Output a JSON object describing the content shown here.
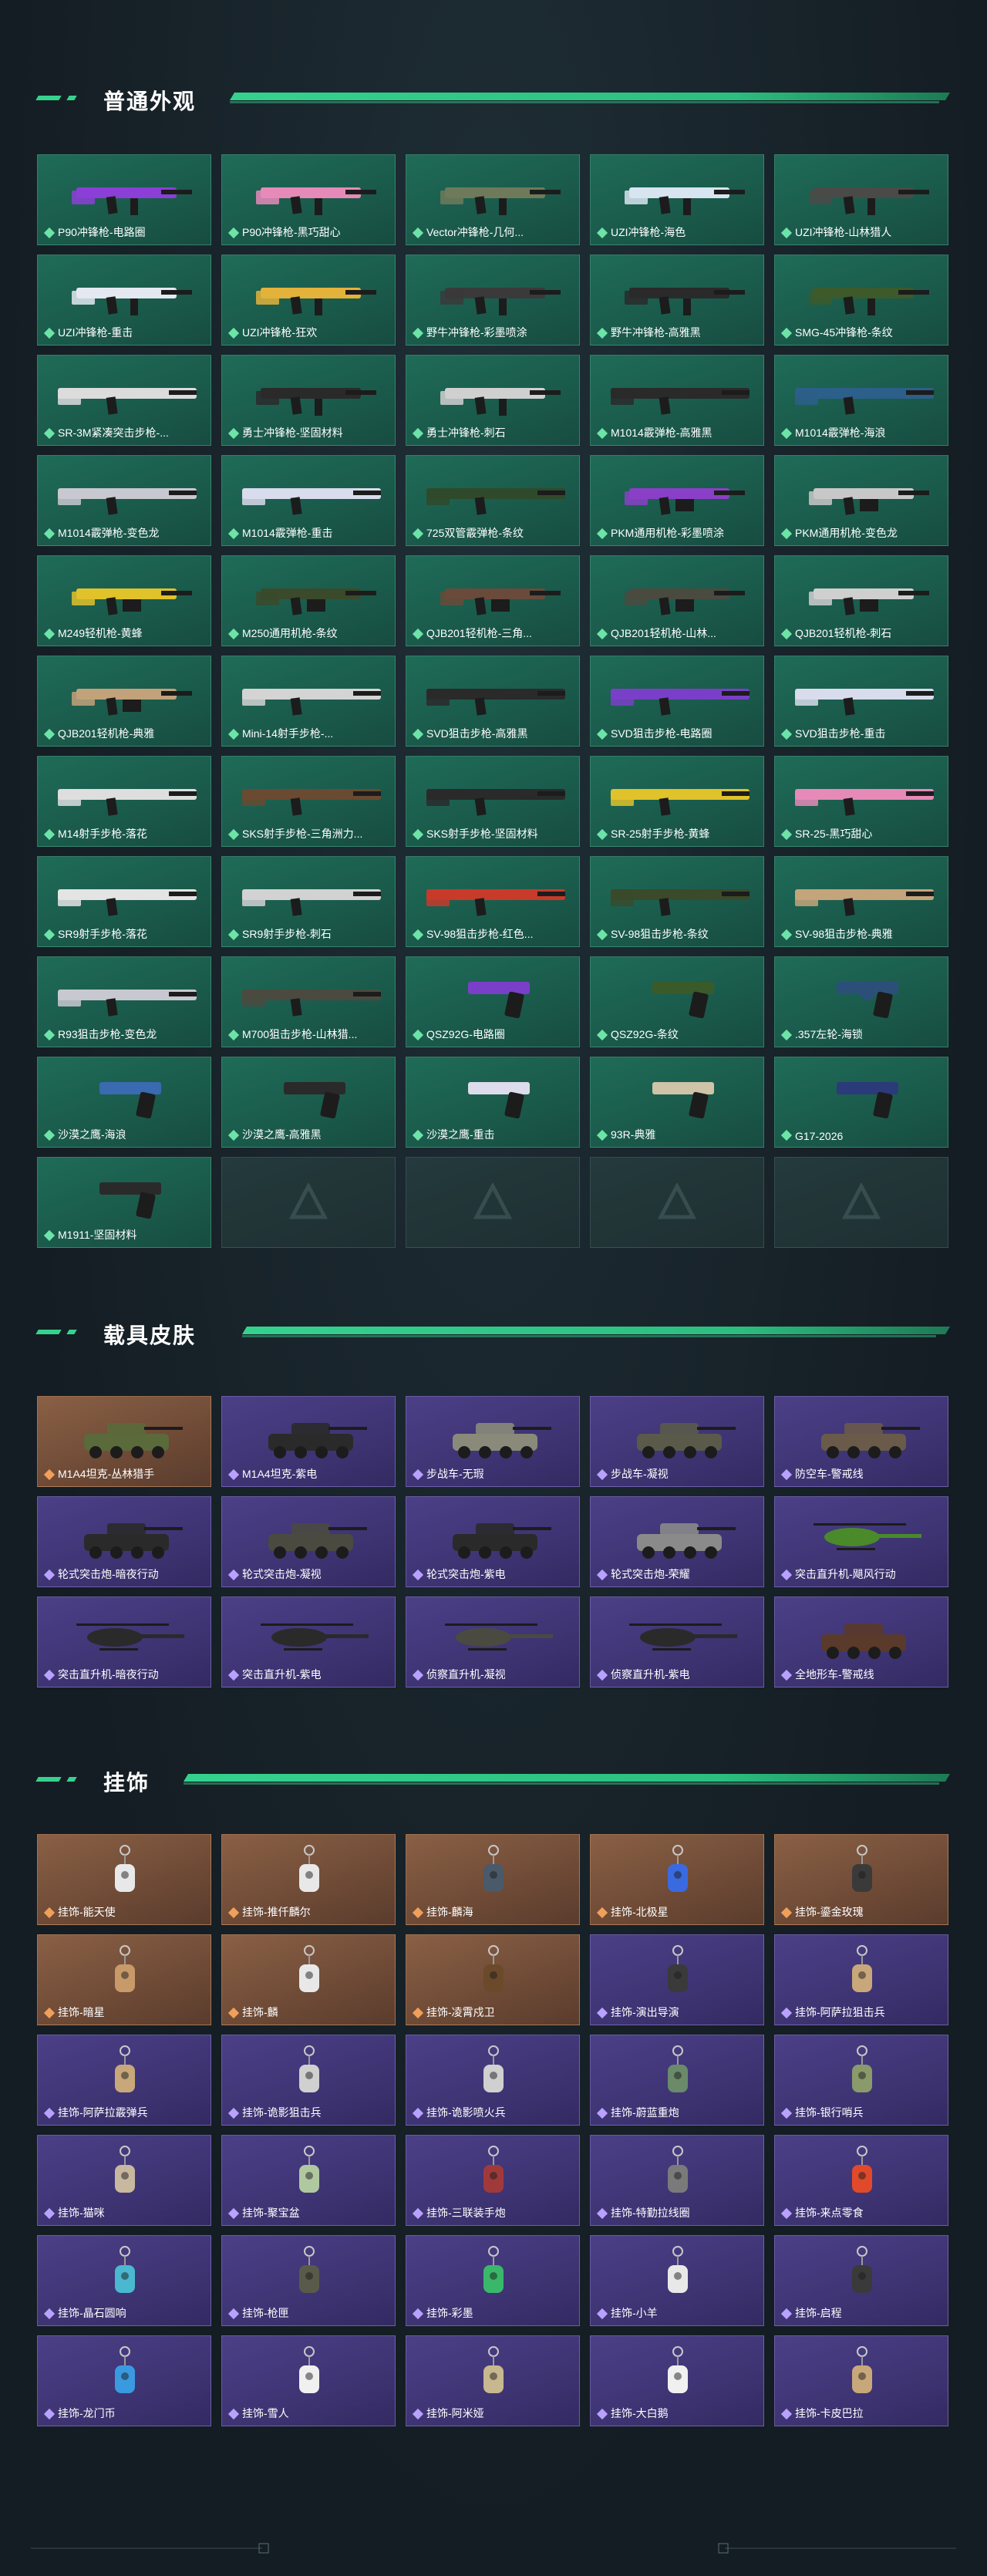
{
  "sections": {
    "weapons": {
      "title": "普通外观",
      "items": [
        {
          "label": "P90冲锋枪-电路圈",
          "icon": "smg-icon",
          "hue": "#8b3fd6"
        },
        {
          "label": "P90冲锋枪-黑巧甜心",
          "icon": "smg-icon",
          "hue": "#e68ab8"
        },
        {
          "label": "Vector冲锋枪-几何...",
          "icon": "smg-icon",
          "hue": "#6f7a5a"
        },
        {
          "label": "UZI冲锋枪-海色",
          "icon": "smg-icon",
          "hue": "#d8e4f0"
        },
        {
          "label": "UZI冲锋枪-山林猎人",
          "icon": "smg-icon",
          "hue": "#4a4a48"
        },
        {
          "label": "UZI冲锋枪-重击",
          "icon": "smg-icon",
          "hue": "#e4e8f0"
        },
        {
          "label": "UZI冲锋枪-狂欢",
          "icon": "smg-icon",
          "hue": "#e3b23a"
        },
        {
          "label": "野牛冲锋枪-彩墨喷涂",
          "icon": "smg-icon",
          "hue": "#3a3a3a"
        },
        {
          "label": "野牛冲锋枪-高雅黑",
          "icon": "smg-icon",
          "hue": "#2a2a2a"
        },
        {
          "label": "SMG-45冲锋枪-条纹",
          "icon": "smg-icon",
          "hue": "#3c5a2a"
        },
        {
          "label": "SR-3M紧凑突击步枪-...",
          "icon": "rifle-icon",
          "hue": "#dcdcdc"
        },
        {
          "label": "勇士冲锋枪-坚固材料",
          "icon": "smg-icon",
          "hue": "#2a2a2a"
        },
        {
          "label": "勇士冲锋枪-刺石",
          "icon": "smg-icon",
          "hue": "#d0d0d0"
        },
        {
          "label": "M1014霰弹枪-高雅黑",
          "icon": "shotgun-icon",
          "hue": "#2a2a2a"
        },
        {
          "label": "M1014霰弹枪-海浪",
          "icon": "shotgun-icon",
          "hue": "#2c5f8a"
        },
        {
          "label": "M1014霰弹枪-变色龙",
          "icon": "shotgun-icon",
          "hue": "#c8c8d0"
        },
        {
          "label": "M1014霰弹枪-重击",
          "icon": "shotgun-icon",
          "hue": "#d8dcec"
        },
        {
          "label": "725双管霰弹枪-条纹",
          "icon": "shotgun-icon",
          "hue": "#2f4a2a"
        },
        {
          "label": "PKM通用机枪-彩墨喷涂",
          "icon": "lmg-icon",
          "hue": "#8a3fc8"
        },
        {
          "label": "PKM通用机枪-变色龙",
          "icon": "lmg-icon",
          "hue": "#c8c8c8"
        },
        {
          "label": "M249轻机枪-黄蜂",
          "icon": "lmg-icon",
          "hue": "#e0c22a"
        },
        {
          "label": "M250通用机枪-条纹",
          "icon": "lmg-icon",
          "hue": "#3a4a2a"
        },
        {
          "label": "QJB201轻机枪-三角...",
          "icon": "lmg-icon",
          "hue": "#6a4a3a"
        },
        {
          "label": "QJB201轻机枪-山林...",
          "icon": "lmg-icon",
          "hue": "#4a4a40"
        },
        {
          "label": "QJB201轻机枪-刺石",
          "icon": "lmg-icon",
          "hue": "#cfcfcf"
        },
        {
          "label": "QJB201轻机枪-典雅",
          "icon": "lmg-icon",
          "hue": "#c2a27a"
        },
        {
          "label": "Mini-14射手步枪-...",
          "icon": "rifle-icon",
          "hue": "#d4d4d4"
        },
        {
          "label": "SVD狙击步枪-高雅黑",
          "icon": "sniper-icon",
          "hue": "#2a2a2a"
        },
        {
          "label": "SVD狙击步枪-电路圈",
          "icon": "sniper-icon",
          "hue": "#7a3fc8"
        },
        {
          "label": "SVD狙击步枪-重击",
          "icon": "sniper-icon",
          "hue": "#d8dcec"
        },
        {
          "label": "M14射手步枪-落花",
          "icon": "rifle-icon",
          "hue": "#dedede"
        },
        {
          "label": "SKS射手步枪-三角洲力...",
          "icon": "rifle-icon",
          "hue": "#6a4a30"
        },
        {
          "label": "SKS射手步枪-坚固材料",
          "icon": "rifle-icon",
          "hue": "#2a2a2a"
        },
        {
          "label": "SR-25射手步枪-黄蜂",
          "icon": "rifle-icon",
          "hue": "#e0c22a"
        },
        {
          "label": "SR-25-黑巧甜心",
          "icon": "rifle-icon",
          "hue": "#e68ab8"
        },
        {
          "label": "SR9射手步枪-落花",
          "icon": "rifle-icon",
          "hue": "#e4e4e4"
        },
        {
          "label": "SR9射手步枪-刺石",
          "icon": "rifle-icon",
          "hue": "#d2d2d2"
        },
        {
          "label": "SV-98狙击步枪-红色...",
          "icon": "sniper-icon",
          "hue": "#c83a2a"
        },
        {
          "label": "SV-98狙击步枪-条纹",
          "icon": "sniper-icon",
          "hue": "#3a4a2a"
        },
        {
          "label": "SV-98狙击步枪-典雅",
          "icon": "sniper-icon",
          "hue": "#c4a47a"
        },
        {
          "label": "R93狙击步枪-变色龙",
          "icon": "sniper-icon",
          "hue": "#c8c8d0"
        },
        {
          "label": "M700狙击步枪-山林猎...",
          "icon": "sniper-icon",
          "hue": "#4a4a40"
        },
        {
          "label": "QSZ92G-电路圈",
          "icon": "pistol-icon",
          "hue": "#7a3fc8"
        },
        {
          "label": "QSZ92G-条纹",
          "icon": "pistol-icon",
          "hue": "#3a5a2a"
        },
        {
          "label": ".357左轮-海锁",
          "icon": "revolver-icon",
          "hue": "#2c4f7a"
        },
        {
          "label": "沙漠之鹰-海浪",
          "icon": "pistol-icon",
          "hue": "#3a6ab0"
        },
        {
          "label": "沙漠之鹰-高雅黑",
          "icon": "pistol-icon",
          "hue": "#2a2a2a"
        },
        {
          "label": "沙漠之鹰-重击",
          "icon": "pistol-icon",
          "hue": "#dcdcec"
        },
        {
          "label": "93R-典雅",
          "icon": "pistol-icon",
          "hue": "#cfc4a8"
        },
        {
          "label": "G17-2026",
          "icon": "pistol-icon",
          "hue": "#2a3a7a"
        },
        {
          "label": "M1911-坚固材料",
          "icon": "pistol-icon",
          "hue": "#2a2a2a"
        }
      ]
    },
    "vehicles": {
      "title": "载具皮肤",
      "items": [
        {
          "label": "M1A4坦克-丛林猎手",
          "icon": "tank-icon",
          "tier": "orange",
          "hue": "#5a6a3a"
        },
        {
          "label": "M1A4坦克-紫电",
          "icon": "tank-icon",
          "tier": "purple",
          "hue": "#2a2a2a"
        },
        {
          "label": "步战车-无瑕",
          "icon": "ifv-icon",
          "tier": "purple",
          "hue": "#8a8a7a"
        },
        {
          "label": "步战车-凝视",
          "icon": "ifv-icon",
          "tier": "purple",
          "hue": "#5a5a4a"
        },
        {
          "label": "防空车-警戒线",
          "icon": "aa-vehicle-icon",
          "tier": "purple",
          "hue": "#6a5a4a"
        },
        {
          "label": "轮式突击炮-暗夜行动",
          "icon": "assault-gun-icon",
          "tier": "purple",
          "hue": "#2a2a2a"
        },
        {
          "label": "轮式突击炮-凝视",
          "icon": "assault-gun-icon",
          "tier": "purple",
          "hue": "#4a4a40"
        },
        {
          "label": "轮式突击炮-紫电",
          "icon": "assault-gun-icon",
          "tier": "purple",
          "hue": "#2a2a2a"
        },
        {
          "label": "轮式突击炮-荣耀",
          "icon": "assault-gun-icon",
          "tier": "purple",
          "hue": "#8a8a8a"
        },
        {
          "label": "突击直升机-飓风行动",
          "icon": "helicopter-icon",
          "tier": "purple",
          "hue": "#4a8a2a"
        },
        {
          "label": "突击直升机-暗夜行动",
          "icon": "helicopter-icon",
          "tier": "purple",
          "hue": "#2a2a2a"
        },
        {
          "label": "突击直升机-紫电",
          "icon": "helicopter-icon",
          "tier": "purple",
          "hue": "#2a2a2a"
        },
        {
          "label": "侦察直升机-凝视",
          "icon": "helicopter-icon",
          "tier": "purple",
          "hue": "#4a4a40"
        },
        {
          "label": "侦察直升机-紫电",
          "icon": "helicopter-icon",
          "tier": "purple",
          "hue": "#2a2a2a"
        },
        {
          "label": "全地形车-警戒线",
          "icon": "atv-icon",
          "tier": "purple",
          "hue": "#5a3a2a"
        }
      ]
    },
    "charms": {
      "title": "挂饰",
      "items": [
        {
          "label": "挂饰-能天使",
          "icon": "charm-icon",
          "tier": "orange",
          "hue": "#e8e8e8"
        },
        {
          "label": "挂饰-推仟麟尔",
          "icon": "charm-icon",
          "tier": "orange",
          "hue": "#e8e8e8"
        },
        {
          "label": "挂饰-麟海",
          "icon": "charm-icon",
          "tier": "orange",
          "hue": "#4a5a6a"
        },
        {
          "label": "挂饰-北极星",
          "icon": "charm-icon",
          "tier": "orange",
          "hue": "#3a6ae0"
        },
        {
          "label": "挂饰-鎏金玫瑰",
          "icon": "charm-icon",
          "tier": "orange",
          "hue": "#3a3a3a"
        },
        {
          "label": "挂饰-暗星",
          "icon": "charm-icon",
          "tier": "orange",
          "hue": "#c89a6a"
        },
        {
          "label": "挂饰-麟",
          "icon": "charm-icon",
          "tier": "orange",
          "hue": "#e8e8e8"
        },
        {
          "label": "挂饰-凌霄戍卫",
          "icon": "charm-icon",
          "tier": "orange",
          "hue": "#6a4a2a"
        },
        {
          "label": "挂饰-演出导演",
          "icon": "charm-icon",
          "tier": "purple",
          "hue": "#3a3a3a"
        },
        {
          "label": "挂饰-阿萨拉狙击兵",
          "icon": "charm-icon",
          "tier": "purple",
          "hue": "#c8a87a"
        },
        {
          "label": "挂饰-阿萨拉霰弹兵",
          "icon": "charm-icon",
          "tier": "purple",
          "hue": "#c8a87a"
        },
        {
          "label": "挂饰-诡影狙击兵",
          "icon": "charm-icon",
          "tier": "purple",
          "hue": "#d0d0d0"
        },
        {
          "label": "挂饰-诡影喷火兵",
          "icon": "charm-icon",
          "tier": "purple",
          "hue": "#d0d0d0"
        },
        {
          "label": "挂饰-蔚蓝重炮",
          "icon": "charm-icon",
          "tier": "purple",
          "hue": "#6a8a6a"
        },
        {
          "label": "挂饰-银行哨兵",
          "icon": "charm-icon",
          "tier": "purple",
          "hue": "#8a9a6a"
        },
        {
          "label": "挂饰-猫咪",
          "icon": "charm-icon",
          "tier": "purple",
          "hue": "#c8b8a0"
        },
        {
          "label": "挂饰-聚宝盆",
          "icon": "charm-icon",
          "tier": "purple",
          "hue": "#b0c8a0"
        },
        {
          "label": "挂饰-三联装手炮",
          "icon": "charm-icon",
          "tier": "purple",
          "hue": "#a03a3a"
        },
        {
          "label": "挂饰-特勤拉线圈",
          "icon": "charm-icon",
          "tier": "purple",
          "hue": "#7a7a7a"
        },
        {
          "label": "挂饰-来点零食",
          "icon": "charm-icon",
          "tier": "purple",
          "hue": "#e04a2a"
        },
        {
          "label": "挂饰-晶石圆响",
          "icon": "charm-icon",
          "tier": "purple",
          "hue": "#4ab8d0"
        },
        {
          "label": "挂饰-枪匣",
          "icon": "charm-icon",
          "tier": "purple",
          "hue": "#5a5a4a"
        },
        {
          "label": "挂饰-彩墨",
          "icon": "charm-icon",
          "tier": "purple",
          "hue": "#3ab86a"
        },
        {
          "label": "挂饰-小羊",
          "icon": "charm-icon",
          "tier": "purple",
          "hue": "#e8e8e8"
        },
        {
          "label": "挂饰-启程",
          "icon": "charm-icon",
          "tier": "purple",
          "hue": "#3a3a3a"
        },
        {
          "label": "挂饰-龙门币",
          "icon": "charm-icon",
          "tier": "purple",
          "hue": "#3a9ae0"
        },
        {
          "label": "挂饰-雪人",
          "icon": "charm-icon",
          "tier": "purple",
          "hue": "#f0f0f0"
        },
        {
          "label": "挂饰-阿米娅",
          "icon": "charm-icon",
          "tier": "purple",
          "hue": "#c8b890"
        },
        {
          "label": "挂饰-大白鹅",
          "icon": "charm-icon",
          "tier": "purple",
          "hue": "#f0f0f0"
        },
        {
          "label": "挂饰-卡皮巴拉",
          "icon": "charm-icon",
          "tier": "purple",
          "hue": "#c8a87a"
        }
      ]
    }
  },
  "colors": {
    "accent": "#35d28e",
    "tier_green": "#1f6b58",
    "tier_orange": "#8a6045",
    "tier_purple": "#4b3f87"
  }
}
